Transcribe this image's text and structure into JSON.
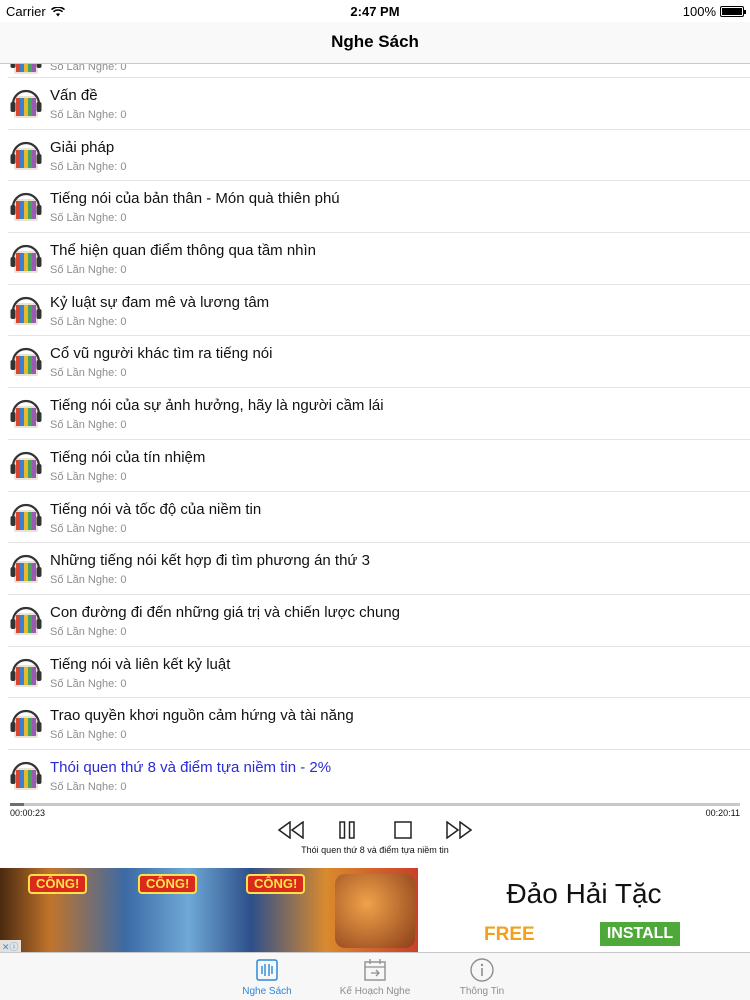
{
  "status_bar": {
    "carrier": "Carrier",
    "time": "2:47 PM",
    "battery": "100%"
  },
  "nav": {
    "title": "Nghe Sách"
  },
  "list": {
    "first_partial_sub": "Số Lần Nghe: 0",
    "items": [
      {
        "title": "Vấn đề",
        "sub": "Số Lần Nghe: 0"
      },
      {
        "title": "Giải pháp",
        "sub": "Số Lần Nghe: 0"
      },
      {
        "title": "Tiếng nói của bản thân - Món quà thiên phú",
        "sub": "Số Lần Nghe: 0"
      },
      {
        "title": "Thể hiện quan điểm thông qua tầm nhìn",
        "sub": "Số Lần Nghe: 0"
      },
      {
        "title": "Kỷ luật sự đam mê và lương tâm",
        "sub": "Số Lần Nghe: 0"
      },
      {
        "title": "Cổ vũ người khác tìm ra tiếng nói",
        "sub": "Số Lần Nghe: 0"
      },
      {
        "title": "Tiếng nói của sự ảnh hưởng, hãy là người cầm lái",
        "sub": "Số Lần Nghe: 0"
      },
      {
        "title": "Tiếng nói của tín nhiệm",
        "sub": "Số Lần Nghe: 0"
      },
      {
        "title": "Tiếng nói và tốc độ của niềm tin",
        "sub": "Số Lần Nghe: 0"
      },
      {
        "title": "Những tiếng nói kết hợp đi tìm phương án thứ 3",
        "sub": "Số Lần Nghe: 0"
      },
      {
        "title": "Con đường đi đến những giá trị và chiến lược chung",
        "sub": "Số Lần Nghe: 0"
      },
      {
        "title": "Tiếng nói và liên kết kỷ luật",
        "sub": "Số Lần Nghe: 0"
      },
      {
        "title": "Trao quyền khơi nguồn cảm hứng và tài năng",
        "sub": "Số Lần Nghe: 0"
      },
      {
        "title": "Thói quen thứ 8 và điểm tựa niềm tin -  2%",
        "sub": "Số Lần Nghe: 0"
      }
    ]
  },
  "player": {
    "current_time": "00:00:23",
    "total_time": "00:20:11",
    "progress_fraction": 0.019,
    "track_name": "Thói quen thứ 8 và điểm tựa niềm tin"
  },
  "ad": {
    "badge_labels": [
      "CÔNG!",
      "CÔNG!",
      "CÔNG!"
    ],
    "title": "Đảo Hải Tặc",
    "free_label": "FREE",
    "install_label": "INSTALL"
  },
  "tabbar": {
    "tabs": [
      {
        "label": "Nghe Sách",
        "icon": "listen-book-icon"
      },
      {
        "label": "Kế Hoạch Nghe",
        "icon": "plan-calendar-icon"
      },
      {
        "label": "Thông Tin",
        "icon": "info-icon"
      }
    ]
  },
  "colors": {
    "active_tint": "#2a88d8",
    "playing_title": "#2b2bd6",
    "install_green": "#4ea83a",
    "free_orange": "#f2a01e"
  }
}
